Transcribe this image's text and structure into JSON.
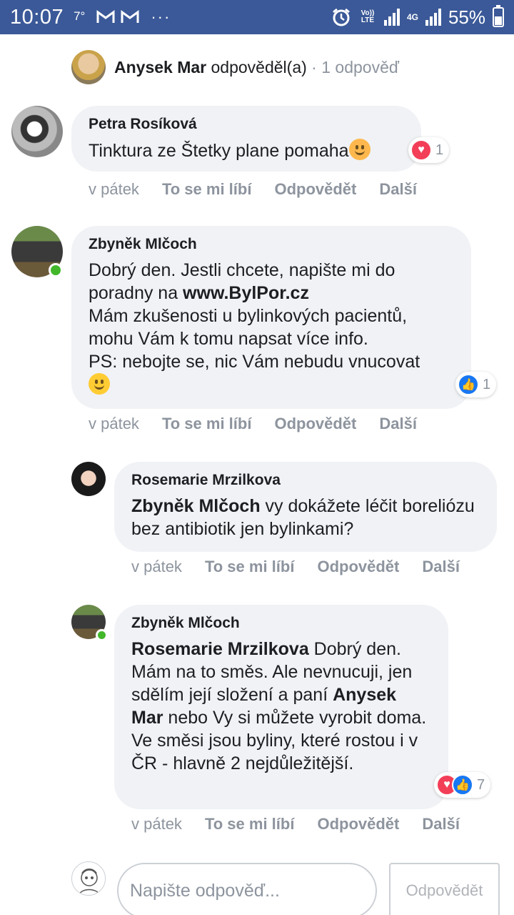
{
  "status_bar": {
    "time": "10:07",
    "temperature": "7°",
    "notification_icons": [
      "gmail-icon",
      "gmail-icon"
    ],
    "more": "···",
    "network_volte": "Vo)) LTE",
    "network_4g": "4G",
    "battery": "55%"
  },
  "thread_header": {
    "author": "Anysek Mar",
    "action": "odpověděl(a)",
    "separator": "·",
    "replies": "1 odpověď"
  },
  "comments": [
    {
      "author": "Petra Rosíková",
      "text": "Tinktura ze Štetky plane pomaha",
      "emoji": "blush-emoji",
      "reactions": {
        "types": [
          "love"
        ],
        "count": "1"
      },
      "actions": {
        "time": "v pátek",
        "like": "To se mi líbí",
        "reply": "Odpovědět",
        "more": "Další"
      }
    },
    {
      "author": "Zbyněk Mlčoch",
      "lines": [
        "Dobrý den. Jestli chcete, napište mi do",
        "poradny na ",
        "www.BylPor.cz",
        "Mám zkušenosti u bylinkových pacientů,",
        "mohu Vám k tomu napsat více info.",
        "PS: nebojte se, nic Vám nebudu vnucovat"
      ],
      "emoji": "smile-emoji",
      "reactions": {
        "types": [
          "like"
        ],
        "count": "1"
      },
      "actions": {
        "time": "v pátek",
        "like": "To se mi líbí",
        "reply": "Odpovědět",
        "more": "Další"
      }
    },
    {
      "author": "Rosemarie Mrzilkova",
      "mention": "Zbyněk Mlčoch",
      "text": " vy dokážete léčit boreliózu bez antibiotik jen bylinkami?",
      "actions": {
        "time": "v pátek",
        "like": "To se mi líbí",
        "reply": "Odpovědět",
        "more": "Další"
      }
    },
    {
      "author": "Zbyněk Mlčoch",
      "mention1": "Rosemarie Mrzilkova",
      "text1": " Dobrý den. Mám na to směs. Ale nevnucuji, jen sdělím její složení a paní ",
      "mention2": "Anysek Mar",
      "text2": " nebo Vy si můžete vyrobit doma. Ve směsi jsou byliny, které rostou i v ČR - hlavně 2 nejdůležitější.",
      "reactions": {
        "types": [
          "love",
          "like"
        ],
        "count": "7"
      },
      "actions": {
        "time": "v pátek",
        "like": "To se mi líbí",
        "reply": "Odpovědět",
        "more": "Další"
      }
    }
  ],
  "composer": {
    "placeholder": "Napište odpověď...",
    "button": "Odpovědět"
  },
  "colors": {
    "status_bar": "#3b5998",
    "bubble": "#f0f2f5",
    "secondary_text": "#8d949e",
    "online": "#42b72a",
    "love": "#f33e58",
    "like": "#1877f2"
  }
}
